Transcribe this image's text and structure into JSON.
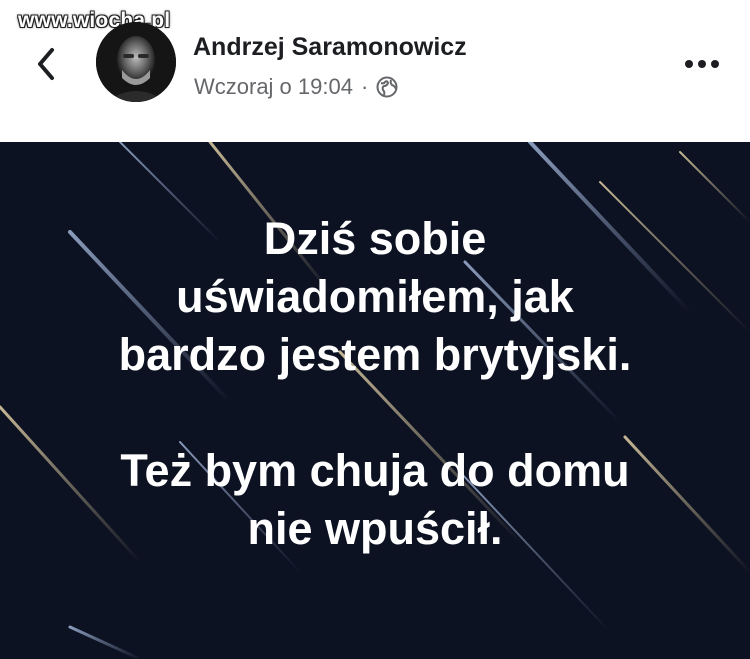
{
  "watermark": "www.wiocha.pl",
  "post": {
    "author": "Andrzej Saramonowicz",
    "time": "Wczoraj o 19:04",
    "separator": "·",
    "privacy_icon": "globe-icon",
    "avatar_icon": "profile-photo"
  },
  "header": {
    "back_icon": "chevron-left-icon",
    "more_icon": "more-dots-icon"
  },
  "image": {
    "background_color": "#0d1222",
    "text_color": "#ffffff",
    "paragraph1": [
      "Dziś sobie",
      "uświadomiłem, jak",
      "bardzo jestem brytyjski."
    ],
    "paragraph2": [
      "Też bym chuja do domu",
      "nie wpuścił."
    ]
  }
}
